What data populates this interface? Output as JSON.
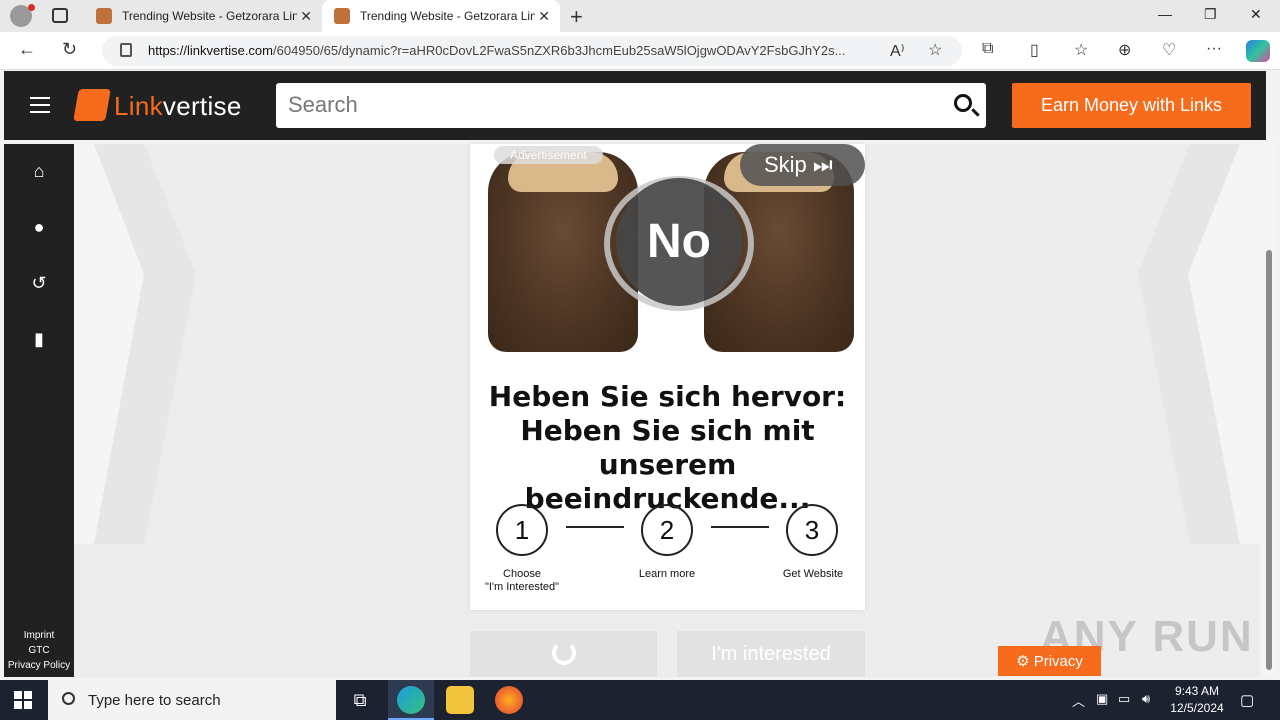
{
  "browser": {
    "tabs": [
      {
        "title": "Trending Website - Getzorara Link",
        "active": false
      },
      {
        "title": "Trending Website - Getzorara Link",
        "active": true
      }
    ],
    "url_domain": "https://linkvertise.com",
    "url_path": "/604950/65/dynamic?r=aHR0cDovL2FwaS5nZXR6b3JhcmEub25saW5lOjgwODAvY2FsbGJhY2s..."
  },
  "header": {
    "logo_link": "Link",
    "logo_rest": "vertise",
    "search_placeholder": "Search",
    "earn_button": "Earn Money with Links"
  },
  "sidebar": {
    "items": [
      {
        "icon": "home-icon"
      },
      {
        "icon": "user-icon"
      },
      {
        "icon": "history-icon"
      },
      {
        "icon": "bookmark-icon"
      }
    ],
    "footer_links": [
      "Imprint",
      "GTC",
      "Privacy Policy"
    ]
  },
  "ad": {
    "label": "Advertisement",
    "skip_label": "Skip",
    "badge": "No",
    "headline_1": "Heben Sie sich hervor:",
    "headline_2": "Heben Sie sich mit",
    "headline_3": "unserem beeindruckende..."
  },
  "steps": [
    {
      "number": "1",
      "label_1": "Choose",
      "label_2": "\"I'm Interested\""
    },
    {
      "number": "2",
      "label_1": "Learn more",
      "label_2": ""
    },
    {
      "number": "3",
      "label_1": "Get Website",
      "label_2": ""
    }
  ],
  "actions": {
    "interested_button": "I'm interested",
    "privacy_button": "Privacy"
  },
  "watermark": "ANY RUN",
  "taskbar": {
    "search_placeholder": "Type here to search",
    "time": "9:43 AM",
    "date": "12/5/2024"
  },
  "colors": {
    "brand_orange": "#f76b1c",
    "header_dark": "#212121"
  }
}
